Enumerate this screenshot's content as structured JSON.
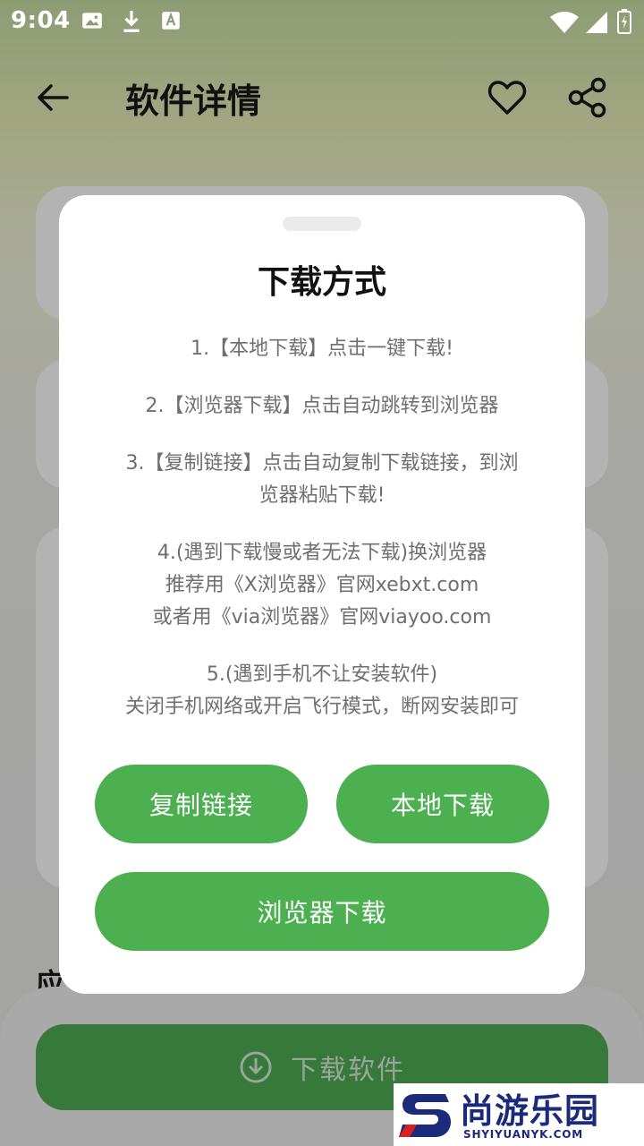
{
  "status_bar": {
    "time": "9:04",
    "left_icons": [
      "image-icon",
      "download-icon",
      "font-icon"
    ],
    "right_icons": [
      "wifi-icon",
      "signal-icon",
      "battery-icon"
    ]
  },
  "app_bar": {
    "title": "软件详情",
    "back_icon": "arrow-left-icon",
    "favorite_icon": "heart-outline-icon",
    "share_icon": "share-icon"
  },
  "background": {
    "section_label": "应",
    "download_button_label": "下载软件"
  },
  "dialog": {
    "title": "下载方式",
    "instructions": {
      "step1": "1.【本地下载】点击一键下载!",
      "step2": "2.【浏览器下载】点击自动跳转到浏览器",
      "step3_line1": "3.【复制链接】点击自动复制下载链接，到浏",
      "step3_line2": "览器粘贴下载!",
      "step4_line1": "4.(遇到下载慢或者无法下载)换浏览器",
      "step4_line2": "推荐用《X浏览器》官网xebxt.com",
      "step4_line3": "或者用《via浏览器》官网viayoo.com",
      "step5_line1": "5.(遇到手机不让安装软件)",
      "step5_line2": "关闭手机网络或开启飞行模式，断网安装即可"
    },
    "buttons": {
      "copy_link": "复制链接",
      "local_download": "本地下载",
      "browser_download": "浏览器下载"
    }
  },
  "watermark": {
    "name": "尚游乐园",
    "url": "SHYIYUANYK.COM"
  },
  "colors": {
    "accent": "#4caf50",
    "download_button_dim": "#37793a",
    "watermark_blue": "#1b2a7a"
  }
}
